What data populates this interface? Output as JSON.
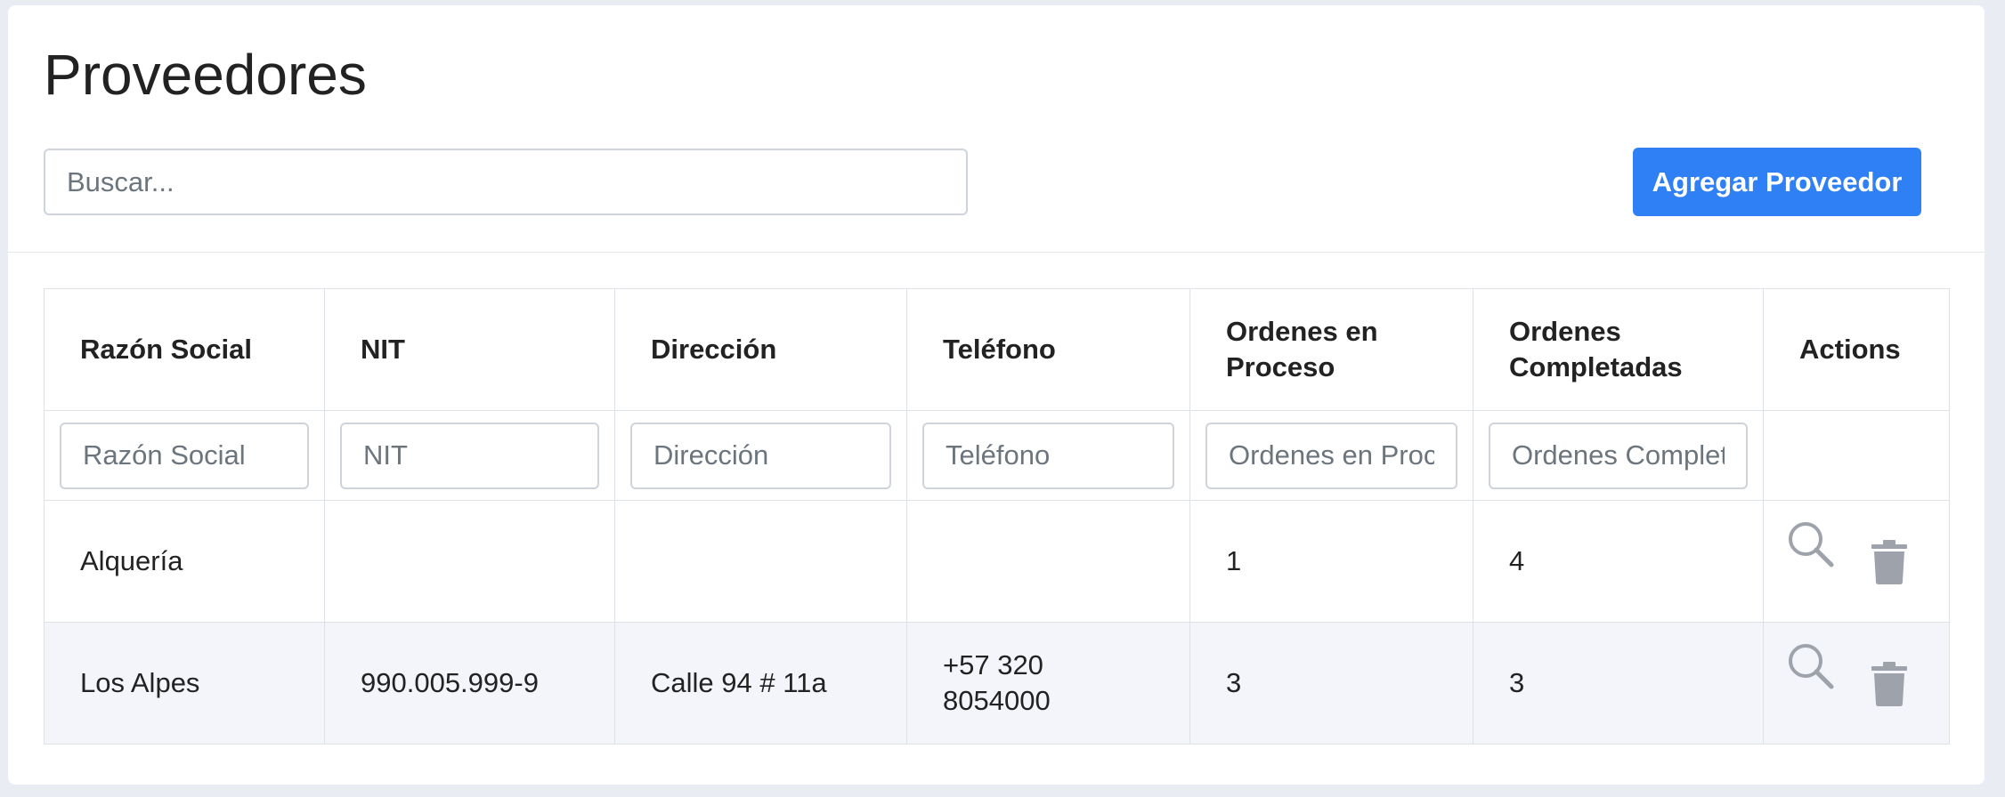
{
  "page": {
    "title": "Proveedores"
  },
  "search": {
    "placeholder": "Buscar..."
  },
  "toolbar": {
    "add_label": "Agregar Proveedor"
  },
  "colors": {
    "primary": "#2f80f5",
    "icon": "#9ea3ab",
    "stripe": "#f3f5fa"
  },
  "table": {
    "columns": [
      "Razón Social",
      "NIT",
      "Dirección",
      "Teléfono",
      "Ordenes en Proceso",
      "Ordenes Completadas",
      "Actions"
    ],
    "filters": [
      "Razón Social",
      "NIT",
      "Dirección",
      "Teléfono",
      "Ordenes en Proceso",
      "Ordenes Completadas"
    ],
    "rows": [
      {
        "razon_social": "Alquería",
        "nit": "",
        "direccion": "",
        "telefono": "",
        "ordenes_proceso": "1",
        "ordenes_completadas": "4"
      },
      {
        "razon_social": "Los Alpes",
        "nit": "990.005.999-9",
        "direccion": "Calle 94 # 11a",
        "telefono": "+57 320 8054000",
        "ordenes_proceso": "3",
        "ordenes_completadas": "3"
      }
    ],
    "action_icons": [
      "search-icon",
      "trash-icon"
    ]
  }
}
